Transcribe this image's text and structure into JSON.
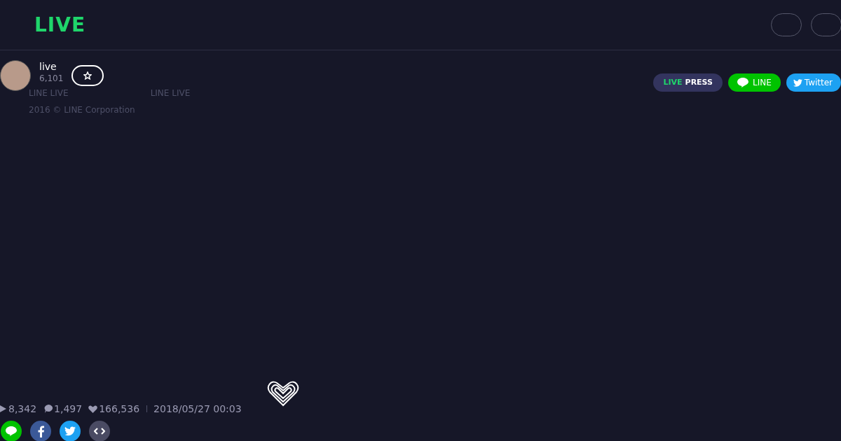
{
  "header": {
    "logo": "LIVE",
    "header_buttons": [
      {
        "kind": "outline"
      },
      {
        "kind": "outline"
      }
    ]
  },
  "channel": {
    "name": "live",
    "followers": "6,101"
  },
  "footer": {
    "links": [
      "LINE LIVE",
      "LINE LIVE"
    ],
    "copyright": "2016 © LINE Corporation"
  },
  "promo_buttons": [
    {
      "kind": "press",
      "label_accent": "LIVE",
      "label": "PRESS"
    },
    {
      "kind": "line",
      "label": "LINE"
    },
    {
      "kind": "twitter",
      "label": "Twitter"
    }
  ],
  "stats": {
    "views": "8,342",
    "comments": "1,497",
    "likes": "166,536",
    "date": "2018/05/27 00:03"
  },
  "share": [
    {
      "kind": "line"
    },
    {
      "kind": "facebook"
    },
    {
      "kind": "twitter"
    },
    {
      "kind": "embed"
    }
  ]
}
